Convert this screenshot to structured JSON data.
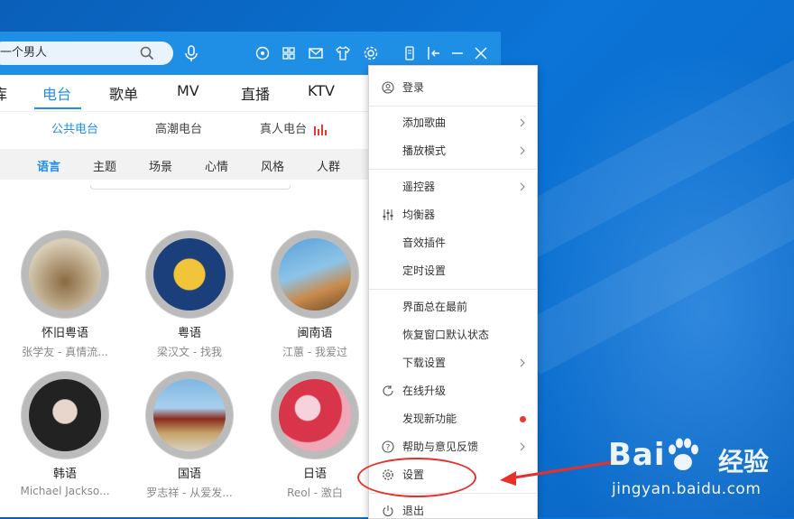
{
  "search": {
    "value": "一个男人"
  },
  "tabs": [
    {
      "label": "库"
    },
    {
      "label": "电台"
    },
    {
      "label": "歌单"
    },
    {
      "label": "MV"
    },
    {
      "label": "直播"
    },
    {
      "label": "KTV"
    }
  ],
  "active_tab": "电台",
  "subtabs": [
    {
      "label": "公共电台"
    },
    {
      "label": "高潮电台"
    },
    {
      "label": "真人电台"
    }
  ],
  "categories": [
    "语言",
    "主题",
    "场景",
    "心情",
    "风格",
    "人群"
  ],
  "active_category": "语言",
  "cards": [
    {
      "title": "怀旧粤语",
      "sub": "张学友 - 真情流..."
    },
    {
      "title": "粤语",
      "sub": "梁汉文 - 找我"
    },
    {
      "title": "闽南语",
      "sub": "江蕙 - 我爱过"
    },
    {
      "title": "韩语",
      "sub": "Michael Jackso..."
    },
    {
      "title": "国语",
      "sub": "罗志祥 - 从爱发..."
    },
    {
      "title": "日语",
      "sub": "Reol - 激白"
    }
  ],
  "menu": {
    "items": [
      {
        "label": "登录",
        "icon": "user-icon"
      },
      {
        "label": "添加歌曲",
        "submenu": true
      },
      {
        "label": "播放模式",
        "submenu": true
      },
      {
        "label": "遥控器",
        "submenu": true
      },
      {
        "label": "均衡器",
        "icon": "equalizer-icon"
      },
      {
        "label": "音效插件"
      },
      {
        "label": "定时设置"
      },
      {
        "label": "界面总在最前"
      },
      {
        "label": "恢复窗口默认状态"
      },
      {
        "label": "下载设置",
        "submenu": true
      },
      {
        "label": "在线升级",
        "icon": "refresh-icon"
      },
      {
        "label": "发现新功能",
        "badge": "red-dot"
      },
      {
        "label": "帮助与意见反馈",
        "icon": "help-icon",
        "submenu": true
      },
      {
        "label": "设置",
        "icon": "gear-icon"
      },
      {
        "label": "退出",
        "icon": "power-icon"
      }
    ]
  },
  "colors": {
    "accent": "#1f8fe6",
    "highlight": "#e8302a",
    "desktop": "#0b74d6"
  },
  "watermark": {
    "logo_left": "Bai",
    "logo_right": "经验",
    "url": "jingyan.baidu.com"
  }
}
